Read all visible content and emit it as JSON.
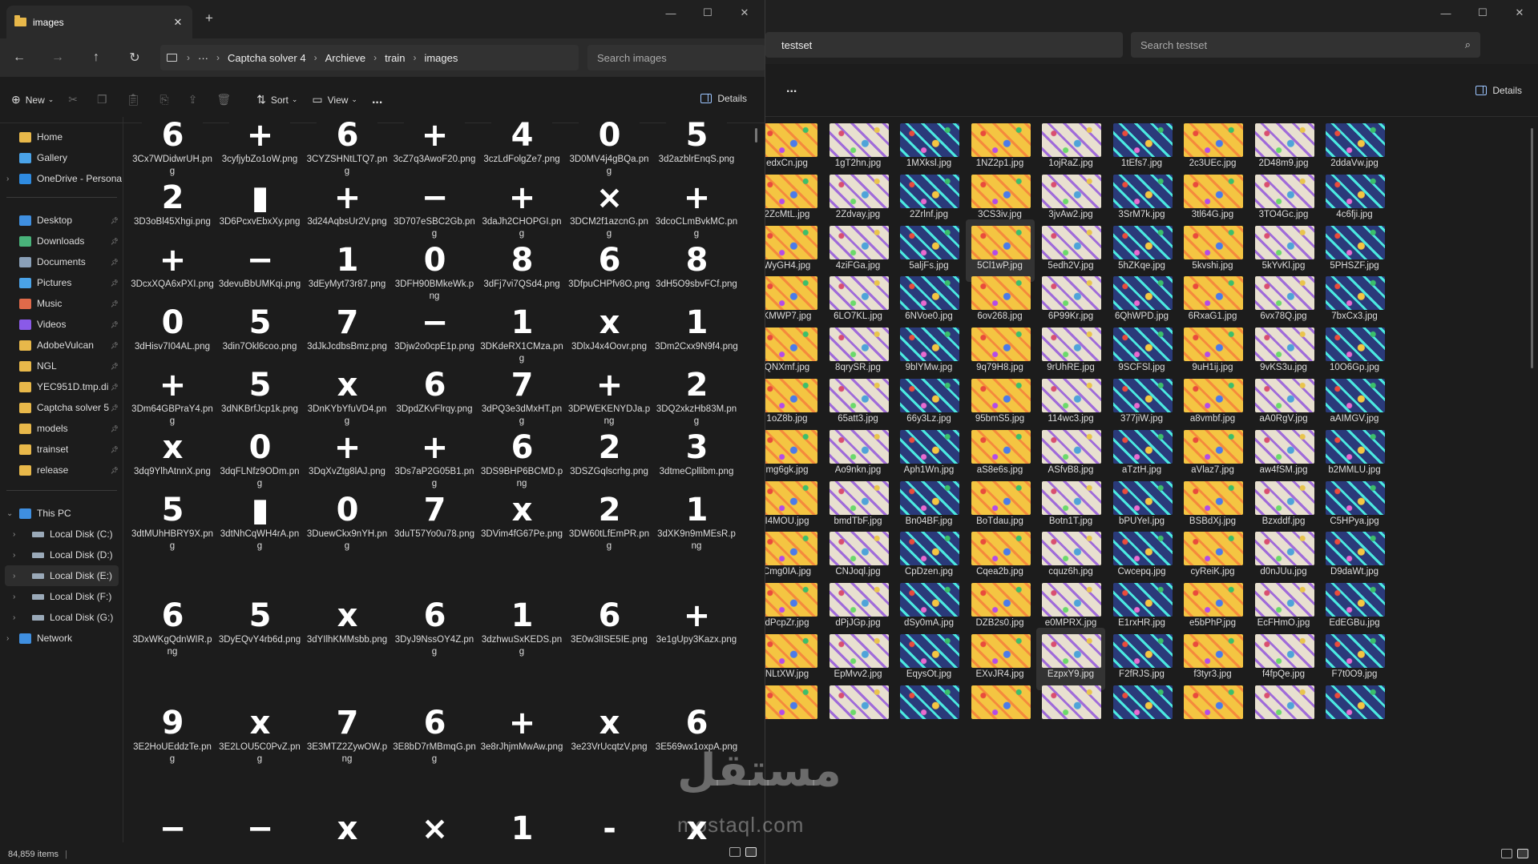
{
  "left_window": {
    "tab_title": "images",
    "breadcrumb": [
      "Captcha solver 4",
      "Archieve",
      "train",
      "images"
    ],
    "search_placeholder": "Search images",
    "commands": {
      "new": "New",
      "sort": "Sort",
      "view": "View",
      "more": "...",
      "details": "Details"
    },
    "nav": [
      {
        "label": "Home",
        "icon": "home-icon",
        "color": "#e8b84a"
      },
      {
        "label": "Gallery",
        "icon": "gallery-icon",
        "color": "#4aa3e8"
      },
      {
        "label": "OneDrive - Persona",
        "icon": "cloud-icon",
        "color": "#2f8be0"
      },
      {
        "label": "Desktop",
        "icon": "desktop-icon",
        "color": "#3f8fe0"
      },
      {
        "label": "Downloads",
        "icon": "download-icon",
        "color": "#49b37a"
      },
      {
        "label": "Documents",
        "icon": "document-icon",
        "color": "#8aa0b8"
      },
      {
        "label": "Pictures",
        "icon": "picture-icon",
        "color": "#4aa3e8"
      },
      {
        "label": "Music",
        "icon": "music-icon",
        "color": "#e06a4a"
      },
      {
        "label": "Videos",
        "icon": "video-icon",
        "color": "#8a5ae8"
      },
      {
        "label": "AdobeVulcan",
        "icon": "folder-icon",
        "color": "#e8b84a"
      },
      {
        "label": "NGL",
        "icon": "folder-icon",
        "color": "#e8b84a"
      },
      {
        "label": "YEC951D.tmp.di",
        "icon": "folder-icon",
        "color": "#e8b84a"
      },
      {
        "label": "Captcha solver 5",
        "icon": "folder-icon",
        "color": "#e8b84a"
      },
      {
        "label": "models",
        "icon": "folder-icon",
        "color": "#e8b84a"
      },
      {
        "label": "trainset",
        "icon": "folder-icon",
        "color": "#e8b84a"
      },
      {
        "label": "release",
        "icon": "folder-icon",
        "color": "#e8b84a"
      },
      {
        "label": "This PC",
        "icon": "pc-icon",
        "color": "#3f8fe0"
      },
      {
        "label": "Local Disk (C:)",
        "icon": "drive-icon",
        "color": "#9aa9b8"
      },
      {
        "label": "Local Disk (D:)",
        "icon": "drive-icon",
        "color": "#9aa9b8"
      },
      {
        "label": "Local Disk (E:)",
        "icon": "drive-icon",
        "color": "#9aa9b8"
      },
      {
        "label": "Local Disk (F:)",
        "icon": "drive-icon",
        "color": "#9aa9b8"
      },
      {
        "label": "Local Disk (G:)",
        "icon": "drive-icon",
        "color": "#9aa9b8"
      },
      {
        "label": "Network",
        "icon": "network-icon",
        "color": "#3f8fe0"
      }
    ],
    "files": [
      {
        "glyph": "6",
        "name": "3Cx7WDidwrUH.png"
      },
      {
        "glyph": "+",
        "name": "3cyfjybZo1oW.png"
      },
      {
        "glyph": "6",
        "name": "3CYZSHNtLTQ7.png"
      },
      {
        "glyph": "+",
        "name": "3cZ7q3AwoF20.png"
      },
      {
        "glyph": "4",
        "name": "3czLdFolgZe7.png"
      },
      {
        "glyph": "0",
        "name": "3D0MV4j4gBQa.png"
      },
      {
        "glyph": "5",
        "name": "3d2azblrEnqS.png"
      },
      {
        "glyph": "2",
        "name": "3D3oBl45Xhgi.png"
      },
      {
        "glyph": "▮",
        "name": "3D6PcxvEbxXy.png"
      },
      {
        "glyph": "+",
        "name": "3d24AqbsUr2V.png"
      },
      {
        "glyph": "−",
        "name": "3D707eSBC2Gb.png"
      },
      {
        "glyph": "+",
        "name": "3daJh2CHOPGI.png"
      },
      {
        "glyph": "×",
        "name": "3DCM2f1azcnG.png"
      },
      {
        "glyph": "+",
        "name": "3dcoCLmBvkMC.png"
      },
      {
        "glyph": "+",
        "name": "3DcxXQA6xPXI.png"
      },
      {
        "glyph": "−",
        "name": "3devuBbUMKqi.png"
      },
      {
        "glyph": "1",
        "name": "3dEyMyt73r87.png"
      },
      {
        "glyph": "0",
        "name": "3DFH90BMkeWk.png"
      },
      {
        "glyph": "8",
        "name": "3dFj7vi7QSd4.png"
      },
      {
        "glyph": "6",
        "name": "3DfpuCHPfv8O.png"
      },
      {
        "glyph": "8",
        "name": "3dH5O9sbvFCf.png"
      },
      {
        "glyph": "0",
        "name": "3dHisv7I04AL.png"
      },
      {
        "glyph": "5",
        "name": "3din7Okl6coo.png"
      },
      {
        "glyph": "7",
        "name": "3dJkJcdbsBmz.png"
      },
      {
        "glyph": "−",
        "name": "3Djw2o0cpE1p.png"
      },
      {
        "glyph": "1",
        "name": "3DKdeRX1CMza.png"
      },
      {
        "glyph": "x",
        "name": "3DlxJ4x4Oovr.png"
      },
      {
        "glyph": "1",
        "name": "3Dm2Cxx9N9f4.png"
      },
      {
        "glyph": "+",
        "name": "3Dm64GBPraY4.png"
      },
      {
        "glyph": "5",
        "name": "3dNKBrfJcp1k.png"
      },
      {
        "glyph": "x",
        "name": "3DnKYbYfuVD4.png"
      },
      {
        "glyph": "6",
        "name": "3DpdZKvFlrqy.png"
      },
      {
        "glyph": "7",
        "name": "3dPQ3e3dMxHT.png"
      },
      {
        "glyph": "+",
        "name": "3DPWEKENYDJa.png"
      },
      {
        "glyph": "2",
        "name": "3DQ2xkzHb83M.png"
      },
      {
        "glyph": "x",
        "name": "3dq9YlhAtnnX.png"
      },
      {
        "glyph": "0",
        "name": "3dqFLNfz9ODm.png"
      },
      {
        "glyph": "+",
        "name": "3DqXvZtg8lAJ.png"
      },
      {
        "glyph": "+",
        "name": "3Ds7aP2G05B1.png"
      },
      {
        "glyph": "6",
        "name": "3DS9BHP6BCMD.png"
      },
      {
        "glyph": "2",
        "name": "3DSZGqlscrhg.png"
      },
      {
        "glyph": "3",
        "name": "3dtmeCpllibm.png"
      },
      {
        "glyph": "5",
        "name": "3dtMUhHBRY9X.png"
      },
      {
        "glyph": "▮",
        "name": "3dtNhCqWH4rA.png"
      },
      {
        "glyph": "0",
        "name": "3DuewCkx9nYH.png"
      },
      {
        "glyph": "7",
        "name": "3duT57Yo0u78.png"
      },
      {
        "glyph": "x",
        "name": "3DVim4fG67Pe.png"
      },
      {
        "glyph": "2",
        "name": "3DW60tLfEmPR.png"
      },
      {
        "glyph": "1",
        "name": "3dXK9n9mMEsR.png"
      },
      {
        "glyph": "6",
        "name": "3DxWKgQdnWIR.png"
      },
      {
        "glyph": "5",
        "name": "3DyEQvY4rb6d.png"
      },
      {
        "glyph": "x",
        "name": "3dYIlhKMMsbb.png"
      },
      {
        "glyph": "6",
        "name": "3DyJ9NssOY4Z.png"
      },
      {
        "glyph": "1",
        "name": "3dzhwuSxKEDS.png"
      },
      {
        "glyph": "6",
        "name": "3E0w3lISE5IE.png"
      },
      {
        "glyph": "+",
        "name": "3e1gUpy3Kazx.png"
      },
      {
        "glyph": "9",
        "name": "3E2HoUEddzTe.png"
      },
      {
        "glyph": "x",
        "name": "3E2LOU5C0PvZ.png"
      },
      {
        "glyph": "7",
        "name": "3E3MTZ2ZywOW.png"
      },
      {
        "glyph": "6",
        "name": "3E8bD7rMBmqG.png"
      },
      {
        "glyph": "+",
        "name": "3e8rJhjmMwAw.png"
      },
      {
        "glyph": "x",
        "name": "3e23VrUcqtzV.png"
      },
      {
        "glyph": "6",
        "name": "3E569wx1oxpA.png"
      },
      {
        "glyph": "−",
        "name": ""
      },
      {
        "glyph": "−",
        "name": ""
      },
      {
        "glyph": "x",
        "name": ""
      },
      {
        "glyph": "×",
        "name": ""
      },
      {
        "glyph": "1",
        "name": ""
      },
      {
        "glyph": "-",
        "name": ""
      },
      {
        "glyph": "x",
        "name": ""
      }
    ],
    "status_count": "84,859 items"
  },
  "right_window": {
    "breadcrumb": "testset",
    "search_placeholder": "Search testset",
    "more": "...",
    "details": "Details",
    "files": [
      "edxCn.jpg",
      "1gT2hn.jpg",
      "1MXksl.jpg",
      "1NZ2p1.jpg",
      "1ojRaZ.jpg",
      "1tEfs7.jpg",
      "2c3UEc.jpg",
      "2D48m9.jpg",
      "2ddaVw.jpg",
      "2ZcMtL.jpg",
      "2Zdvay.jpg",
      "2Zrlnf.jpg",
      "3CS3iv.jpg",
      "3jvAw2.jpg",
      "3SrM7k.jpg",
      "3tl64G.jpg",
      "3TO4Gc.jpg",
      "4c6fji.jpg",
      "WyGH4.jpg",
      "4ziFGa.jpg",
      "5aljFs.jpg",
      "5Cl1wP.jpg",
      "5edh2V.jpg",
      "5hZKqe.jpg",
      "5kvshi.jpg",
      "5kYvKl.jpg",
      "5PHSZF.jpg",
      "KMWP7.jpg",
      "6LO7KL.jpg",
      "6NVoe0.jpg",
      "6ov268.jpg",
      "6P99Kr.jpg",
      "6QhWPD.jpg",
      "6RxaG1.jpg",
      "6vx78Q.jpg",
      "7bxCx3.jpg",
      "QNXmf.jpg",
      "8qrySR.jpg",
      "9blYMw.jpg",
      "9q79H8.jpg",
      "9rUhRE.jpg",
      "9SCFSl.jpg",
      "9uH1ij.jpg",
      "9vKS3u.jpg",
      "10O6Gp.jpg",
      "1oZ8b.jpg",
      "65att3.jpg",
      "66y3Lz.jpg",
      "95bmS5.jpg",
      "114wc3.jpg",
      "377jiW.jpg",
      "a8vmbf.jpg",
      "aA0RgV.jpg",
      "aAIMGV.jpg",
      "mg6gk.jpg",
      "Ao9nkn.jpg",
      "Aph1Wn.jpg",
      "aS8e6s.jpg",
      "ASfvB8.jpg",
      "aTztH.jpg",
      "aVlaz7.jpg",
      "aw4fSM.jpg",
      "b2MMLU.jpg",
      "I4MOU.jpg",
      "bmdTbF.jpg",
      "Bn04BF.jpg",
      "BoTdau.jpg",
      "Botn1T.jpg",
      "bPUYeI.jpg",
      "BSBdXj.jpg",
      "Bzxddf.jpg",
      "C5HPya.jpg",
      "Cmg0IA.jpg",
      "CNJoql.jpg",
      "CpDzen.jpg",
      "Cqea2b.jpg",
      "cquz6h.jpg",
      "Cwcepq.jpg",
      "cyReiK.jpg",
      "d0nJUu.jpg",
      "D9daWt.jpg",
      "dPcpZr.jpg",
      "dPjJGp.jpg",
      "dSy0mA.jpg",
      "DZB2s0.jpg",
      "e0MPRX.jpg",
      "E1rxHR.jpg",
      "e5bPhP.jpg",
      "EcFHmO.jpg",
      "EdEGBu.jpg",
      "NLtXW.jpg",
      "EpMvv2.jpg",
      "EqysOt.jpg",
      "EXvJR4.jpg",
      "EzpxY9.jpg",
      "F2fRJS.jpg",
      "f3tyr3.jpg",
      "f4fpQe.jpg",
      "F7t0O9.jpg",
      "",
      "",
      "",
      "",
      "",
      "",
      "",
      "",
      ""
    ]
  },
  "watermark": {
    "arabic": "مستقل",
    "latin": "mostaql.com"
  }
}
